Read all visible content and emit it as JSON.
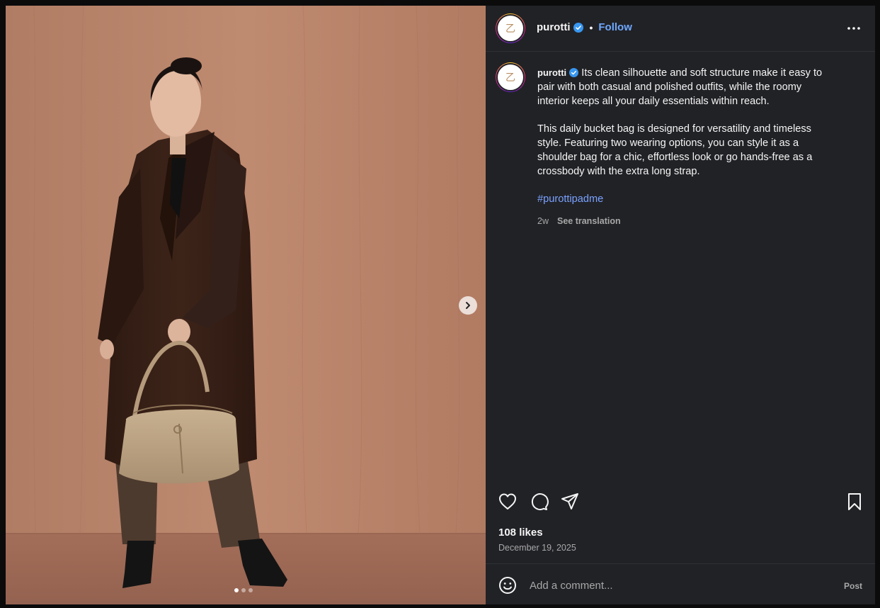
{
  "post": {
    "username": "purotti",
    "follow_label": "Follow",
    "separator": "•",
    "logo_text": "乙",
    "caption_username": "purotti",
    "caption_paragraph_1": "Its clean silhouette and soft structure make it easy to pair with both casual and polished outfits, while the roomy interior keeps all your daily essentials within reach.",
    "caption_paragraph_2": "This daily bucket bag is designed for versatility and timeless style. Featuring two wearing options, you can style it as a shoulder bag for a chic, effortless look or go hands-free as a crossbody with the extra long strap.",
    "hashtag": "#purottipadme",
    "age": "2w",
    "see_translation": "See translation",
    "likes": "108 likes",
    "date": "December 19, 2025"
  },
  "comment": {
    "placeholder": "Add a comment...",
    "post_label": "Post"
  },
  "carousel": {
    "slide_count": 3,
    "active_index": 0
  },
  "icons": {
    "verified": "verified-badge-icon",
    "more": "more-options-icon",
    "like": "heart-icon",
    "comment": "comment-bubble-icon",
    "share": "send-icon",
    "save": "bookmark-icon",
    "emoji": "emoji-icon",
    "next": "chevron-right-icon"
  },
  "colors": {
    "follow": "#6ea8ff",
    "hashtag": "#7aa2ff",
    "verified": "#3897f0",
    "panel": "#212226"
  }
}
